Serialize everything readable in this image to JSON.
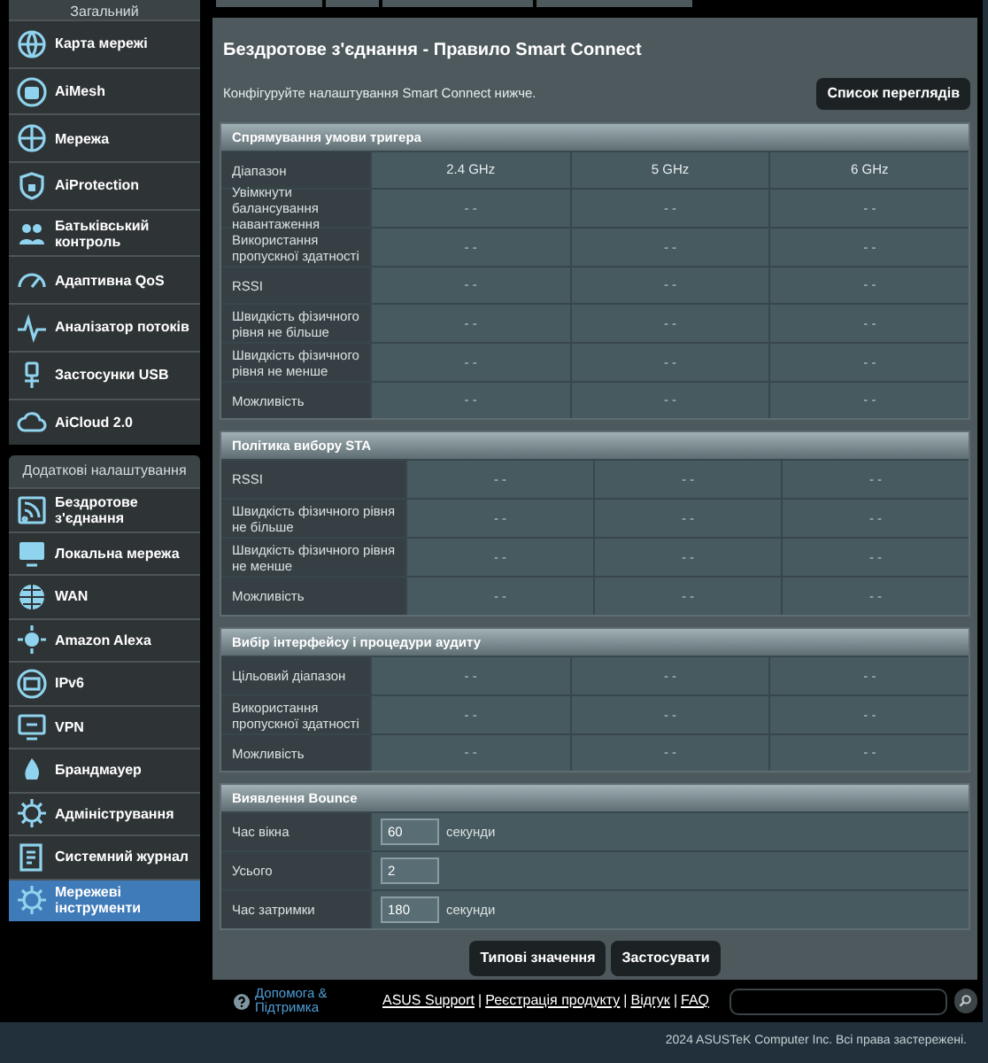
{
  "sidebar": {
    "sections": [
      {
        "title": "Загальний",
        "items": [
          {
            "label": "Карта мережі",
            "selected": false
          },
          {
            "label": "AiMesh",
            "selected": false
          },
          {
            "label": "Мережа",
            "selected": false
          },
          {
            "label": "AiProtection",
            "selected": false
          },
          {
            "label": "Батьківський контроль",
            "selected": false
          },
          {
            "label": "Адаптивна QoS",
            "selected": false
          },
          {
            "label": "Аналізатор потоків",
            "selected": false
          },
          {
            "label": "Застосунки USB",
            "selected": false
          },
          {
            "label": "AiCloud 2.0",
            "selected": false
          }
        ]
      },
      {
        "title": "Додаткові налаштування",
        "items": [
          {
            "label": "Бездротове з'єднання",
            "selected": false
          },
          {
            "label": "Локальна мережа",
            "selected": false
          },
          {
            "label": "WAN",
            "selected": false
          },
          {
            "label": "Amazon Alexa",
            "selected": false
          },
          {
            "label": "IPv6",
            "selected": false
          },
          {
            "label": "VPN",
            "selected": false
          },
          {
            "label": "Брандмауер",
            "selected": false
          },
          {
            "label": "Адміністрування",
            "selected": false
          },
          {
            "label": "Системний журнал",
            "selected": false
          },
          {
            "label": "Мережеві інструменти",
            "selected": true
          }
        ]
      }
    ]
  },
  "page": {
    "title": "Бездротове з'єднання - Правило Smart Connect",
    "description": "Конфігуруйте налаштування Smart Connect нижче.",
    "view_list_button": "Список переглядів"
  },
  "sections": [
    {
      "kind": "table",
      "title": "Спрямування умови тригера",
      "header": [
        "Діапазон",
        "2.4 GHz",
        "5 GHz",
        "6 GHz"
      ],
      "rows": [
        {
          "label": "Увімкнути балансування навантаження",
          "values": [
            "- -",
            "- -",
            "- -"
          ]
        },
        {
          "label": "Використання пропускної здатності",
          "values": [
            "- -",
            "- -",
            "- -"
          ]
        },
        {
          "label": "RSSI",
          "values": [
            "- -",
            "- -",
            "- -"
          ]
        },
        {
          "label": "Швидкість фізичного рівня не більше",
          "values": [
            "- -",
            "- -",
            "- -"
          ]
        },
        {
          "label": "Швидкість фізичного рівня не менше",
          "values": [
            "- -",
            "- -",
            "- -"
          ]
        },
        {
          "label": "Можливість",
          "values": [
            "- -",
            "- -",
            "- -"
          ]
        }
      ]
    },
    {
      "kind": "table",
      "title": "Політика вибору STA",
      "rows": [
        {
          "label": "RSSI",
          "values": [
            "- -",
            "- -",
            "- -"
          ]
        },
        {
          "label": "Швидкість фізичного рівня не більше",
          "values": [
            "- -",
            "- -",
            "- -"
          ]
        },
        {
          "label": "Швидкість фізичного рівня не менше",
          "values": [
            "- -",
            "- -",
            "- -"
          ]
        },
        {
          "label": "Можливість",
          "values": [
            "- -",
            "- -",
            "- -"
          ]
        }
      ]
    },
    {
      "kind": "table",
      "title": "Вибір інтерфейсу і процедури аудиту",
      "rows": [
        {
          "label": "Цільовий діапазон",
          "values": [
            "- -",
            "- -",
            "- -"
          ]
        },
        {
          "label": "Використання пропускної здатності",
          "values": [
            "- -",
            "- -",
            "- -"
          ]
        },
        {
          "label": "Можливість",
          "values": [
            "- -",
            "- -",
            "- -"
          ]
        }
      ]
    },
    {
      "kind": "form",
      "title": "Виявлення Bounce",
      "rows": [
        {
          "label": "Час вікна",
          "value": "60",
          "unit": "секунди"
        },
        {
          "label": "Усього",
          "value": "2"
        },
        {
          "label": "Час затримки",
          "value": "180",
          "unit": "секунди"
        }
      ]
    }
  ],
  "buttons": [
    "Типові значення",
    "Застосувати"
  ],
  "footer": {
    "help": "Допомога & Підтримка",
    "links": [
      "ASUS Support",
      "Реєстрація продукту",
      "Відгук",
      "FAQ"
    ],
    "separator": "|",
    "copyright": "2024 ASUSTeK Computer Inc. Всі права застережені."
  }
}
